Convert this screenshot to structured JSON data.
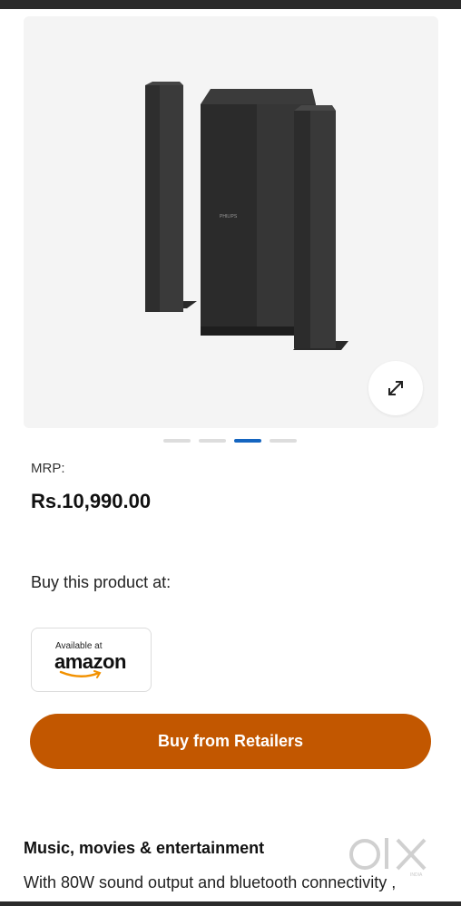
{
  "product": {
    "image_alt": "Philips speaker system",
    "logo_text": "PHILIPS",
    "mrp_label": "MRP:",
    "price": "Rs.10,990.00"
  },
  "carousel": {
    "total_slides": 4,
    "active_index": 2
  },
  "retailers": {
    "heading": "Buy this product at:",
    "amazon": {
      "available_text": "Available at",
      "brand_text": "amazon"
    },
    "buy_button_label": "Buy from Retailers"
  },
  "description": {
    "title": "Music, movies & entertainment",
    "text": "With 80W sound output and bluetooth connectivity ,"
  },
  "watermark": {
    "brand": "olx",
    "sub": "INDIA"
  },
  "colors": {
    "accent_button": "#c25700",
    "active_dot": "#1565c0",
    "gallery_bg": "#f4f4f4"
  }
}
